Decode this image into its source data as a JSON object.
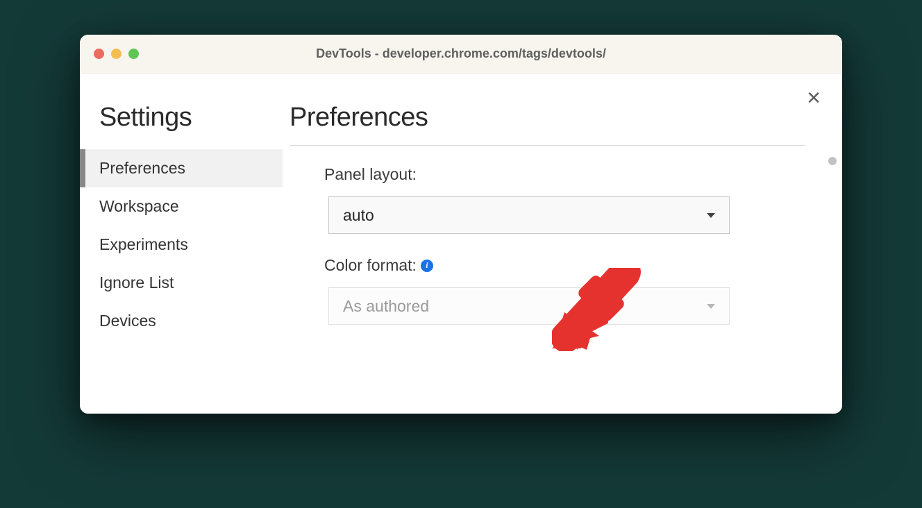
{
  "window": {
    "title": "DevTools - developer.chrome.com/tags/devtools/"
  },
  "sidebar": {
    "title": "Settings",
    "items": [
      {
        "label": "Preferences",
        "selected": true
      },
      {
        "label": "Workspace",
        "selected": false
      },
      {
        "label": "Experiments",
        "selected": false
      },
      {
        "label": "Ignore List",
        "selected": false
      },
      {
        "label": "Devices",
        "selected": false
      }
    ]
  },
  "main": {
    "title": "Preferences",
    "settings": {
      "panel_layout": {
        "label": "Panel layout:",
        "value": "auto"
      },
      "color_format": {
        "label": "Color format:",
        "value": "As authored",
        "has_info": true,
        "disabled": true
      }
    }
  },
  "annotation": {
    "arrow_color": "#e6322f"
  }
}
